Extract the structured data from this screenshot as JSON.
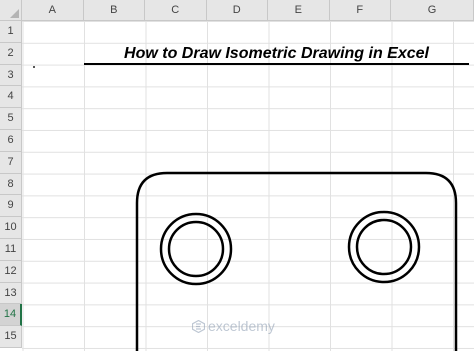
{
  "columns": [
    "A",
    "B",
    "C",
    "D",
    "E",
    "F",
    "G"
  ],
  "rows": [
    "1",
    "2",
    "3",
    "4",
    "5",
    "6",
    "7",
    "8",
    "9",
    "10",
    "11",
    "12",
    "13",
    "14",
    "15"
  ],
  "selected_row": "14",
  "title_text": "How to Draw Isometric Drawing in Excel",
  "watermark": {
    "text": "exceldemy",
    "icon": "exceldemy-logo-icon"
  },
  "colors": {
    "header_bg": "#e6e6e6",
    "gridline": "#e1e1e1",
    "select_accent": "#217346"
  }
}
